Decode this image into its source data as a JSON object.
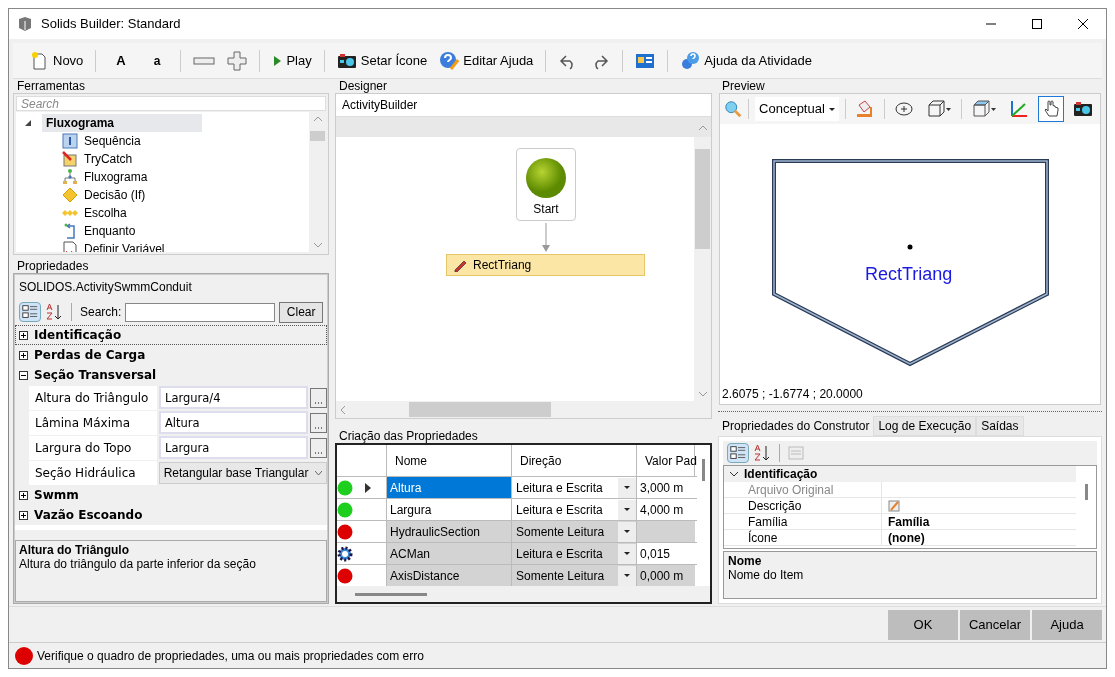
{
  "window": {
    "title": "Solids Builder: Standard"
  },
  "toolbar": [
    {
      "kind": "new",
      "label": "Novo"
    },
    {
      "kind": "bold-text",
      "label": "A"
    },
    {
      "kind": "small-text",
      "label": "a"
    },
    {
      "kind": "collapse"
    },
    {
      "kind": "expand"
    },
    {
      "kind": "play",
      "label": "Play"
    },
    {
      "kind": "camera",
      "label": "Setar Ícone"
    },
    {
      "kind": "help-edit",
      "label": "Editar Ajuda"
    },
    {
      "kind": "undo"
    },
    {
      "kind": "redo"
    },
    {
      "kind": "panel"
    },
    {
      "kind": "help-gear",
      "label": "Ajuda da Atividade"
    }
  ],
  "tools": {
    "title": "Ferramentas",
    "search_placeholder": "Search",
    "tree": [
      {
        "label": "Fluxograma",
        "expanded": true,
        "selected": true,
        "children": [
          {
            "kind": "sequence",
            "label": "Sequência"
          },
          {
            "kind": "trycatch",
            "label": "TryCatch"
          },
          {
            "kind": "flowchart",
            "label": "Fluxograma"
          },
          {
            "kind": "decision",
            "label": "Decisão (If)"
          },
          {
            "kind": "switch",
            "label": "Escolha"
          },
          {
            "kind": "loop",
            "label": "Enquanto"
          },
          {
            "kind": "variable",
            "label": "Definir Variável"
          }
        ]
      }
    ]
  },
  "properties": {
    "title": "Propriedades",
    "object": "SOLIDOS.ActivitySwmmConduit",
    "search_label": "Search:",
    "clear_label": "Clear",
    "categories": [
      {
        "label": "Identificação",
        "expanded": false,
        "selected": true
      },
      {
        "label": "Perdas de Carga",
        "expanded": false,
        "selected": false
      },
      {
        "label": "Seção Transversal",
        "expanded": true,
        "selected": false,
        "rows": [
          {
            "name": "Altura do Triângulo",
            "value": "Largura/4",
            "kind": "editor"
          },
          {
            "name": "Lâmina Máxima",
            "value": "Altura",
            "kind": "editor"
          },
          {
            "name": "Largura do Topo",
            "value": "Largura",
            "kind": "editor"
          },
          {
            "name": "Seção Hidráulica",
            "value": "Retangular base Triangular",
            "kind": "dropdown"
          }
        ]
      },
      {
        "label": "Swmm",
        "expanded": false,
        "selected": false
      },
      {
        "label": "Vazão Escoando",
        "expanded": false,
        "selected": false
      }
    ],
    "help_title": "Altura do Triângulo",
    "help_text": "Altura do triângulo da parte inferior da seção"
  },
  "designer": {
    "title": "Designer",
    "breadcrumb": "ActivityBuilder",
    "start_label": "Start",
    "activity_label": "RectTriang"
  },
  "creation": {
    "title": "Criação das Propriedades",
    "columns": [
      "Nome",
      "Direção",
      "Valor Pad"
    ],
    "rows": [
      {
        "kind": "dot",
        "color": "#1fcf1f",
        "current": true,
        "selected": true,
        "locked": false,
        "value_locked": false,
        "name": "Altura",
        "direction": "Leitura e Escrita",
        "value": "3,000 m"
      },
      {
        "kind": "dot",
        "color": "#1fcf1f",
        "current": false,
        "selected": false,
        "locked": false,
        "value_locked": false,
        "name": "Largura",
        "direction": "Leitura e Escrita",
        "value": "4,000 m"
      },
      {
        "kind": "dot",
        "color": "#dd0000",
        "current": false,
        "selected": false,
        "locked": true,
        "value_locked": true,
        "name": "HydraulicSection",
        "direction": "Somente Leitura"
      },
      {
        "kind": "gear",
        "current": false,
        "selected": false,
        "locked": true,
        "value_locked": false,
        "name": "ACMan",
        "direction": "Leitura e Escrita",
        "value": "0,015"
      },
      {
        "kind": "dot",
        "color": "#dd0000",
        "current": false,
        "selected": false,
        "locked": true,
        "value_locked": true,
        "name": "AxisDistance",
        "direction": "Somente Leitura",
        "value": "0,000 m"
      }
    ]
  },
  "preview": {
    "title": "Preview",
    "view_mode": "Conceptual",
    "tools": [
      {
        "kind": "paint",
        "selected": false
      },
      {
        "kind": "orbit",
        "selected": false
      },
      {
        "kind": "box",
        "selected": false
      },
      {
        "kind": "view",
        "selected": false
      },
      {
        "kind": "axes",
        "selected": false
      },
      {
        "kind": "hand",
        "selected": true
      },
      {
        "kind": "camera",
        "selected": false
      }
    ],
    "shape_label": "RectTriang",
    "coordinates": "2.6075 ; -1.6774 ; 20.0000"
  },
  "bottom_tabs": [
    {
      "label": "Propriedades do Construtor",
      "selected": true
    },
    {
      "label": "Log de Execução",
      "selected": false
    },
    {
      "label": "Saídas",
      "selected": false
    }
  ],
  "builder_grid": {
    "category": "Identificação",
    "expanded": true,
    "rows": [
      {
        "name": "Arquivo Original",
        "disabled": true,
        "kind": "text"
      },
      {
        "name": "Descrição",
        "disabled": false,
        "kind": "editor"
      },
      {
        "name": "Família",
        "disabled": false,
        "kind": "bold",
        "value": "Família"
      },
      {
        "name": "Ícone",
        "disabled": false,
        "kind": "bold",
        "value": "(none)"
      }
    ],
    "help_title": "Nome",
    "help_text": "Nome do Item"
  },
  "buttons": [
    "OK",
    "Cancelar",
    "Ajuda"
  ],
  "status_bar": {
    "color": "#dd0000",
    "message": "Verifique o quadro de propriedades, uma ou mais propriedades com erro"
  }
}
